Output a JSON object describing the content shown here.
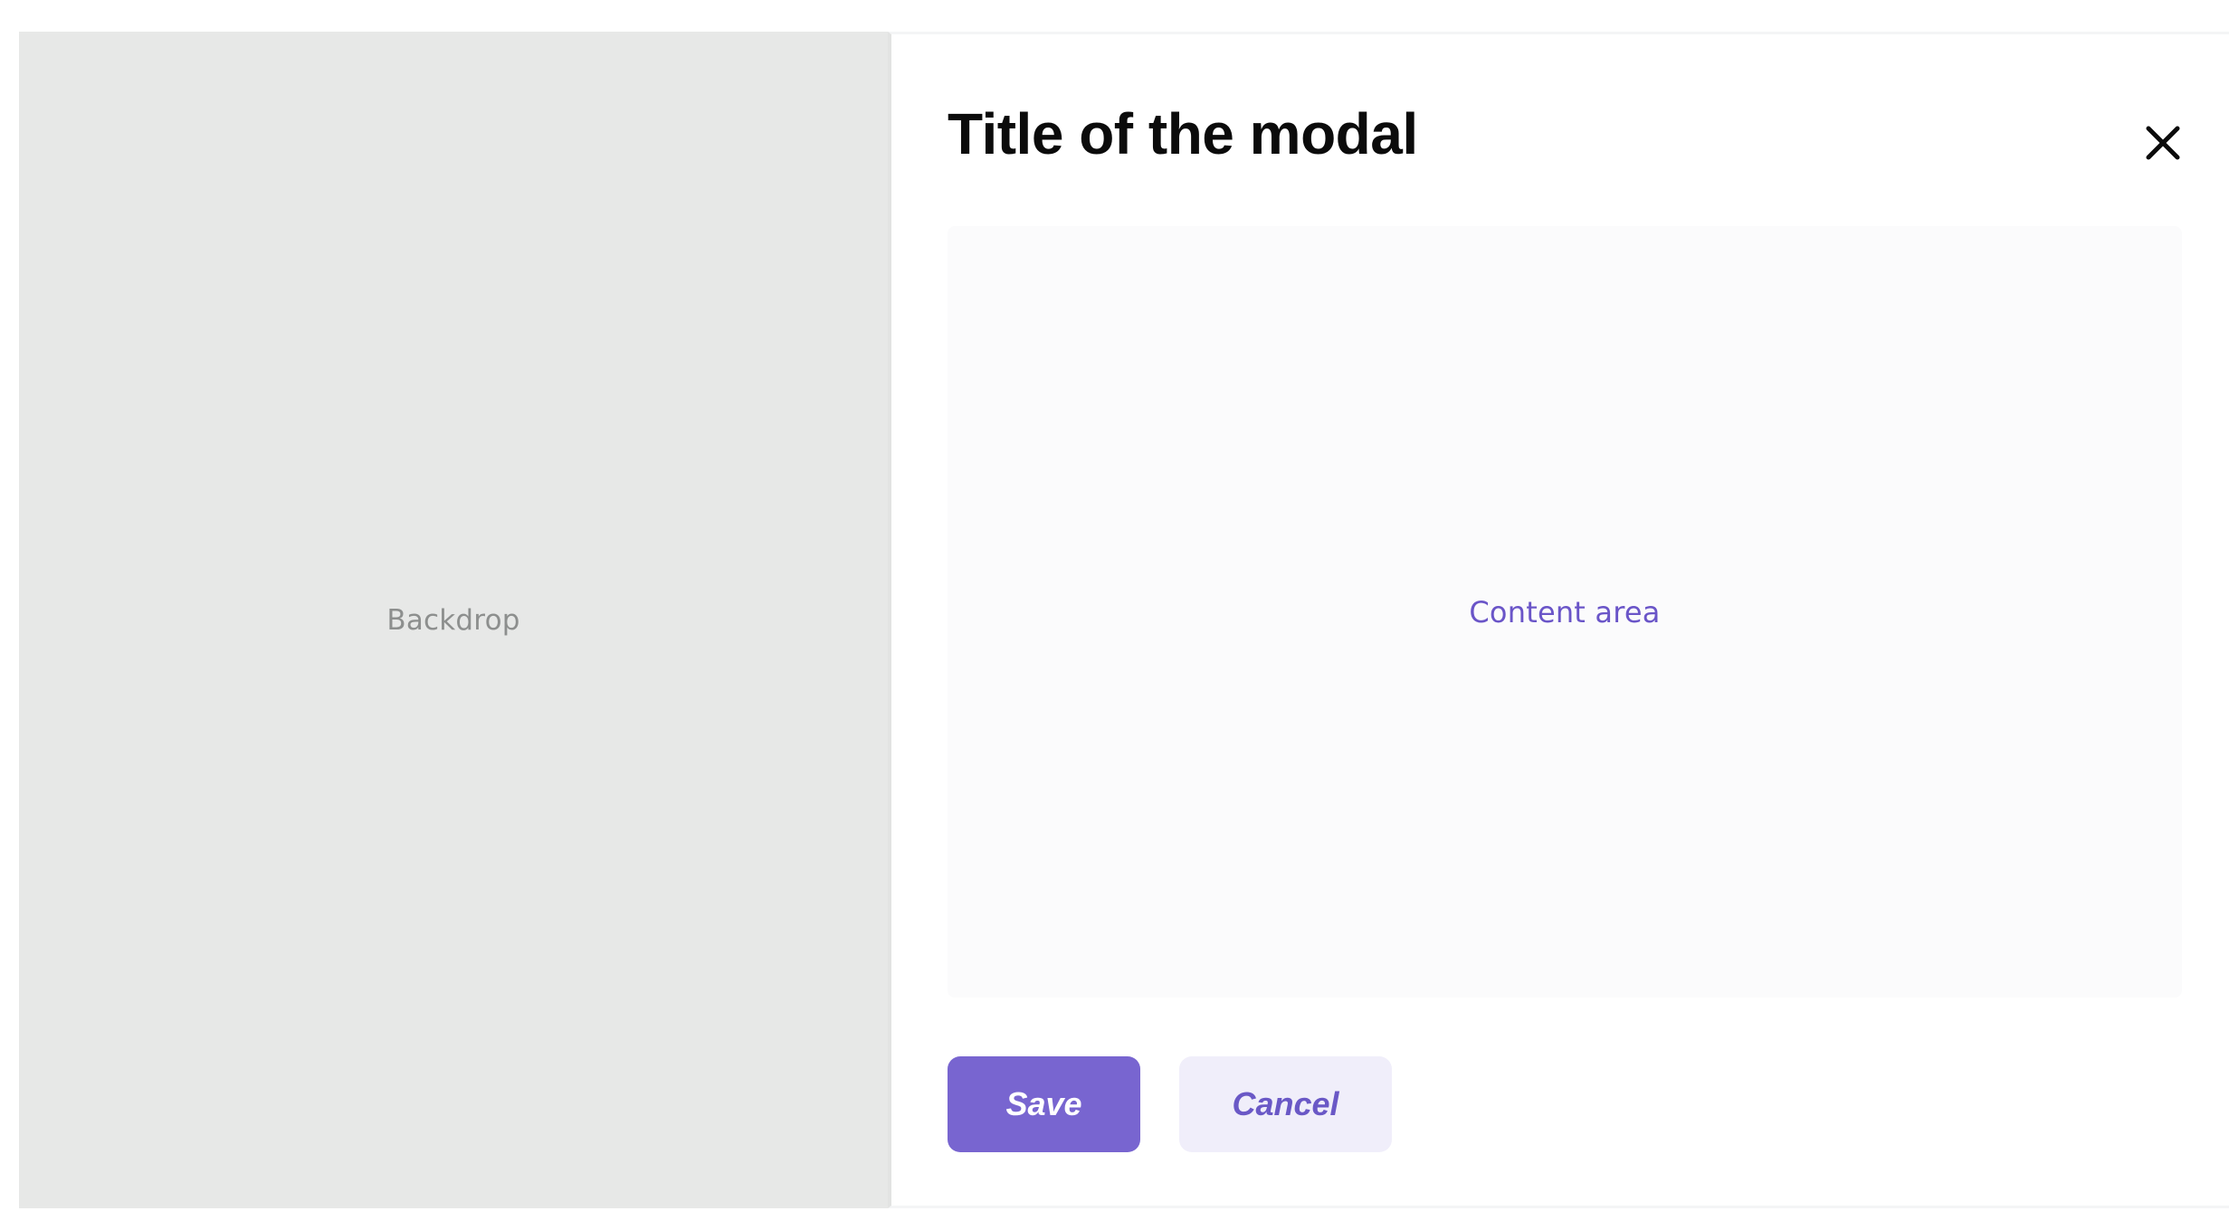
{
  "backdrop": {
    "label": "Backdrop"
  },
  "modal": {
    "title": "Title of the modal",
    "close_icon": "close-icon",
    "content_label": "Content area",
    "actions": {
      "save_label": "Save",
      "cancel_label": "Cancel"
    }
  },
  "colors": {
    "backdrop": "#e7e8e7",
    "accent": "#7865d0",
    "accent_text": "#6a55c8",
    "secondary_button_bg": "#f0eefa",
    "content_bg": "#fbfbfc"
  }
}
